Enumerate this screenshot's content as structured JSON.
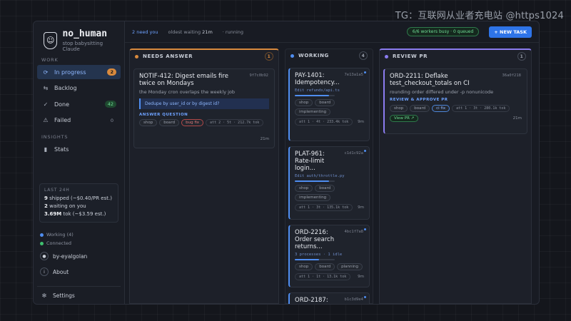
{
  "watermark": "TG：互联网从业者充电站 @https1024",
  "brand": {
    "title": "no_human",
    "subtitle": "stop babysitting Claude"
  },
  "sidebar": {
    "work_label": "WORK",
    "items": [
      {
        "label": "In progress",
        "count": "2",
        "icon": "spinner-icon"
      },
      {
        "label": "Backlog",
        "count": "",
        "icon": "backlog-icon"
      },
      {
        "label": "Done",
        "count": "42",
        "icon": "check-circle-icon"
      },
      {
        "label": "Failed",
        "count": "0",
        "icon": "warning-icon"
      }
    ],
    "insights_label": "INSIGHTS",
    "stats_item": {
      "label": "Stats",
      "icon": "bar-chart-icon"
    },
    "stats_box": {
      "title": "LAST 24H",
      "line1_num": "9",
      "line1_text": "shipped (~$0.40/PR est.)",
      "line2_num": "2",
      "line2_text": "waiting on you",
      "line3_num": "3.69M",
      "line3_text": "tok (~$3.59 est.)"
    },
    "status_working": "Working (4)",
    "status_connected": "Connected",
    "user": "by-eyalgolan",
    "about": "About",
    "settings": "Settings"
  },
  "topbar": {
    "need_you": "2 need you",
    "oldest": "oldest waiting",
    "oldest_value": "21m",
    "running": "running",
    "workers": "6/6 workers busy · 0 queued",
    "new_task": "+ NEW TASK"
  },
  "columns": {
    "needs_answer": {
      "label": "NEEDS ANSWER",
      "count": "1",
      "color": "#d98a3d",
      "card": {
        "title": "NOTIF-412: Digest emails fire twice on Mondays",
        "id": "9f7c0b92",
        "desc": "the Monday cron overlaps the weekly job",
        "callout": "Dedupe by user_id or by digest id?",
        "section": "ANSWER QUESTION",
        "tags": [
          "shop",
          "board",
          "bug fix"
        ],
        "meta": "att 2 · 5t · 212.7k tok",
        "elapsed": "21m"
      }
    },
    "working": {
      "label": "WORKING",
      "count": "4",
      "color": "#4f8df0",
      "cards": [
        {
          "title": "PAY-1401: Idempotency...",
          "id": "7e13a1a5",
          "file": "Edit refunds/api.ts",
          "progress": 0.85,
          "tags": [
            "shop",
            "board",
            "implementing"
          ],
          "meta": "att 1 · 4t · 233.4k tok",
          "elapsed": "9m"
        },
        {
          "title": "PLAT-961: Rate-limit login...",
          "id": "c1d1c92a",
          "file": "Edit auth/throttle.py",
          "progress": 0.85,
          "tags": [
            "shop",
            "board",
            "implementing"
          ],
          "meta": "att 1 · 3t · 135.1k tok",
          "elapsed": "9m"
        },
        {
          "title": "ORD-2216: Order search returns...",
          "id": "4bc1f7a8",
          "file": "3 processes · 1 idle",
          "progress": 0.6,
          "tags": [
            "shop",
            "board",
            "planning"
          ],
          "meta": "att 1 · 1t · 13.1k tok",
          "elapsed": "9m"
        },
        {
          "title": "ORD-2187:",
          "id": "b1c3d9e4",
          "file": "",
          "progress": 0,
          "tags": [],
          "meta": "",
          "elapsed": ""
        }
      ]
    },
    "review_pr": {
      "label": "REVIEW PR",
      "count": "1",
      "color": "#8b7cf0",
      "card": {
        "title": "ORD-2211: Deflake test_checkout_totals on CI",
        "id": "36a0f218",
        "desc": "rounding order differed under -p nonunicode",
        "section": "REVIEW & APPROVE PR",
        "tags": [
          "shop",
          "board",
          "ci fix"
        ],
        "meta": "att 1 · 3t · 280.1k tok",
        "view_pr": "View PR ↗",
        "elapsed": "21m"
      }
    }
  }
}
